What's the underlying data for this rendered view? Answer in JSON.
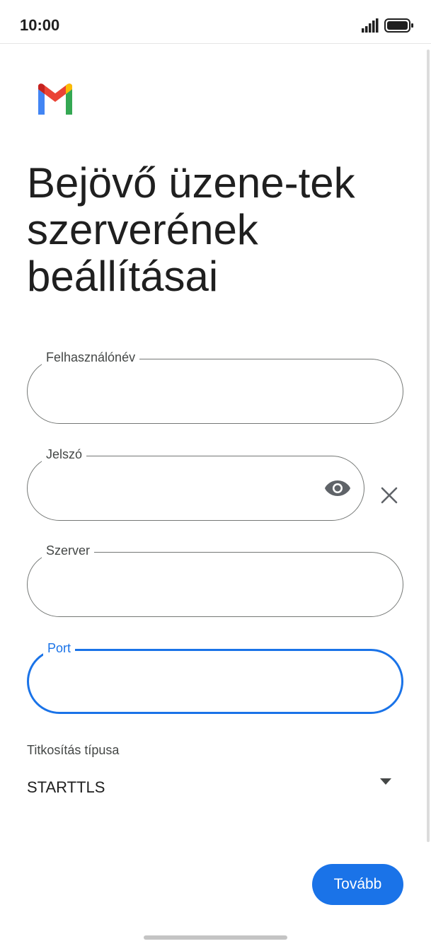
{
  "status_bar": {
    "time": "10:00"
  },
  "page": {
    "title": "Bejövő üzene-tek szerverének beállításai"
  },
  "form": {
    "username": {
      "label": "Felhasználónév",
      "value": ""
    },
    "password": {
      "label": "Jelszó",
      "value": ""
    },
    "server": {
      "label": "Szerver",
      "value": ""
    },
    "port": {
      "label": "Port",
      "value": ""
    },
    "encryption": {
      "label": "Titkosítás típusa",
      "value": "STARTTLS"
    }
  },
  "actions": {
    "next_label": "Tovább"
  },
  "colors": {
    "accent": "#1a73e8",
    "outline": "#747775",
    "text": "#1f1f1f"
  },
  "icons": [
    "signal-icon",
    "battery-icon",
    "gmail-logo",
    "eye-icon",
    "clear-icon",
    "dropdown-icon"
  ]
}
